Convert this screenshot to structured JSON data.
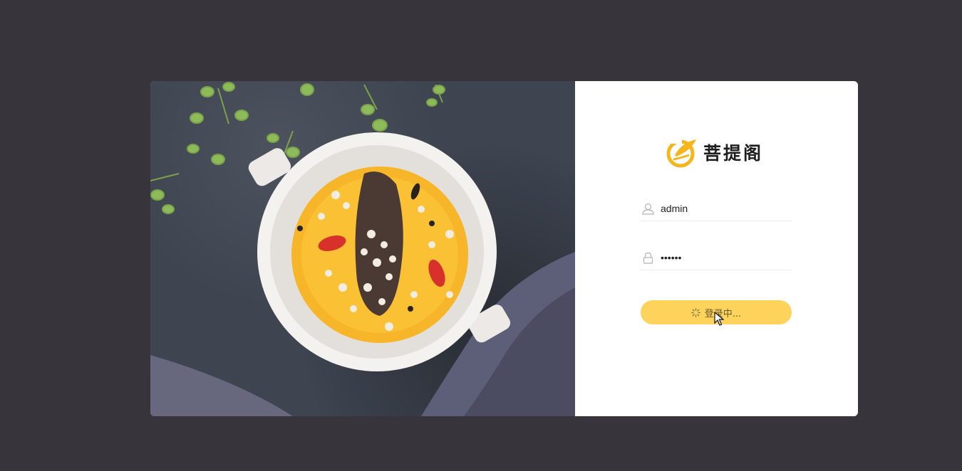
{
  "brand": {
    "name": "菩提阁",
    "logo_color": "#f5b51b"
  },
  "form": {
    "username": {
      "value": "admin",
      "icon": "user-icon"
    },
    "password": {
      "value": "••••••",
      "icon": "lock-icon"
    },
    "login_button": {
      "label": "登录中...",
      "icon": "loading-spinner-icon",
      "color": "#fdd35c"
    }
  },
  "colors": {
    "background": "#38343b",
    "panel": "#ffffff",
    "accent": "#fdd35c"
  }
}
